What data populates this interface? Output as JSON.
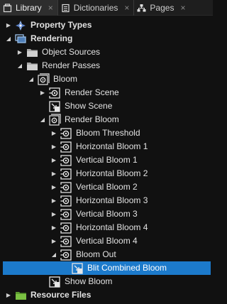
{
  "tabs": [
    {
      "label": "Library",
      "icon": "library-icon",
      "active": true
    },
    {
      "label": "Dictionaries",
      "icon": "dictionary-icon",
      "active": false
    },
    {
      "label": "Pages",
      "icon": "pages-icon",
      "active": false
    }
  ],
  "tab_close_glyph": "×",
  "colors": {
    "background": "#111111",
    "tabbar": "#1e1e1e",
    "active_tab": "#2e2e2e",
    "selection": "#1c7acb",
    "folder_green": "#7ac142"
  },
  "tree": [
    {
      "label": "Property Types",
      "level": 0,
      "expander": "collapsed",
      "icon": "property-types-icon",
      "bold": true
    },
    {
      "label": "Rendering",
      "level": 0,
      "expander": "expanded",
      "icon": "rendering-icon",
      "bold": true
    },
    {
      "label": "Object Sources",
      "level": 1,
      "expander": "collapsed",
      "icon": "folder-icon"
    },
    {
      "label": "Render Passes",
      "level": 1,
      "expander": "expanded",
      "icon": "folder-icon"
    },
    {
      "label": "Bloom",
      "level": 2,
      "expander": "expanded",
      "icon": "render-pass-group-icon"
    },
    {
      "label": "Render Scene",
      "level": 3,
      "expander": "collapsed",
      "icon": "render-pass-icon"
    },
    {
      "label": "Show Scene",
      "level": 3,
      "expander": "none",
      "icon": "blit-icon"
    },
    {
      "label": "Render Bloom",
      "level": 3,
      "expander": "expanded",
      "icon": "render-pass-group-icon"
    },
    {
      "label": "Bloom Threshold",
      "level": 4,
      "expander": "collapsed",
      "icon": "render-pass-icon"
    },
    {
      "label": "Horizontal Bloom 1",
      "level": 4,
      "expander": "collapsed",
      "icon": "render-pass-icon"
    },
    {
      "label": "Vertical Bloom 1",
      "level": 4,
      "expander": "collapsed",
      "icon": "render-pass-icon"
    },
    {
      "label": "Horizontal Bloom 2",
      "level": 4,
      "expander": "collapsed",
      "icon": "render-pass-icon"
    },
    {
      "label": "Vertical Bloom 2",
      "level": 4,
      "expander": "collapsed",
      "icon": "render-pass-icon"
    },
    {
      "label": "Horizontal Bloom 3",
      "level": 4,
      "expander": "collapsed",
      "icon": "render-pass-icon"
    },
    {
      "label": "Vertical Bloom 3",
      "level": 4,
      "expander": "collapsed",
      "icon": "render-pass-icon"
    },
    {
      "label": "Horizontal Bloom 4",
      "level": 4,
      "expander": "collapsed",
      "icon": "render-pass-icon"
    },
    {
      "label": "Vertical Bloom 4",
      "level": 4,
      "expander": "collapsed",
      "icon": "render-pass-icon"
    },
    {
      "label": "Bloom Out",
      "level": 4,
      "expander": "expanded",
      "icon": "render-pass-icon"
    },
    {
      "label": "Blit Combined Bloom",
      "level": 5,
      "expander": "none",
      "icon": "blit-icon",
      "selected": true
    },
    {
      "label": "Show Bloom",
      "level": 3,
      "expander": "none",
      "icon": "blit-icon"
    },
    {
      "label": "Resource Files",
      "level": 0,
      "expander": "collapsed",
      "icon": "folder-icon",
      "bold": true,
      "folder_color": "green"
    }
  ]
}
